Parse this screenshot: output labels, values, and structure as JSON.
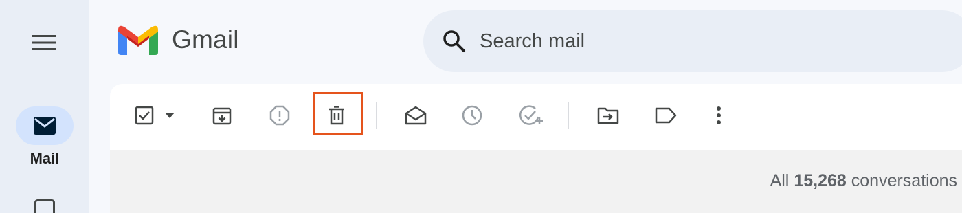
{
  "app": {
    "logo_text": "Gmail"
  },
  "nav": {
    "mail_label": "Mail"
  },
  "search": {
    "placeholder": "Search mail"
  },
  "toolbar": {
    "buttons": [
      {
        "name": "select-checkbox",
        "icon": "checkbox-icon",
        "enabled": true
      },
      {
        "name": "select-dropdown",
        "icon": "caret-down-icon",
        "enabled": true
      },
      {
        "name": "archive-button",
        "icon": "archive-icon",
        "enabled": true
      },
      {
        "name": "report-spam-button",
        "icon": "report-icon",
        "enabled": false
      },
      {
        "name": "delete-button",
        "icon": "trash-icon",
        "enabled": true,
        "highlighted": true
      },
      {
        "name": "mark-read-button",
        "icon": "envelope-open-icon",
        "enabled": true
      },
      {
        "name": "snooze-button",
        "icon": "clock-icon",
        "enabled": false
      },
      {
        "name": "add-task-button",
        "icon": "add-task-icon",
        "enabled": false
      },
      {
        "name": "move-to-button",
        "icon": "folder-move-icon",
        "enabled": true
      },
      {
        "name": "labels-button",
        "icon": "label-icon",
        "enabled": true
      },
      {
        "name": "more-button",
        "icon": "more-vert-icon",
        "enabled": true
      }
    ]
  },
  "status": {
    "prefix": "All",
    "count": "15,268",
    "suffix": "conversations"
  },
  "colors": {
    "highlight": "#e5541d",
    "icon_dark": "#444746",
    "icon_disabled": "#9aa0a6",
    "nav_pill": "#d3e3fd"
  }
}
